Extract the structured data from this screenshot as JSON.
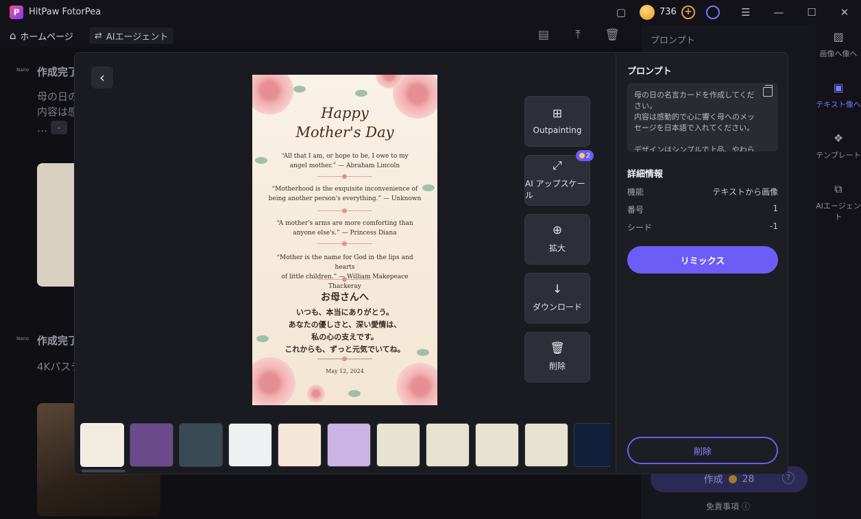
{
  "app": {
    "title": "HitPaw FotorPea",
    "credits": "736",
    "logo": "P"
  },
  "nav": {
    "home": "ホームページ",
    "agent": "AIエージェント"
  },
  "background": {
    "item1_title": "作成完了",
    "item1_line1": "母の日の",
    "item1_line2": "内容は感",
    "item2_title": "作成完了",
    "item2_line1": "4Kパステ",
    "badge_label": "Nano",
    "right_title": "プロンプト",
    "sidebar": [
      "画像へ像へ",
      "テキスト像へ",
      "テンプレート",
      "AIエージェント"
    ],
    "make_label": "作成",
    "make_cost": "28",
    "disclaimer": "免責事項"
  },
  "card": {
    "title_line1": "Happy",
    "title_line2": "Mother's Day",
    "quotes": [
      {
        "l1": "“All that I am, or hope to be, I owe to my",
        "l2": "angel mother.” — Abraham Lincoln"
      },
      {
        "l1": "“Motherhood is the exquisite inconvenience of",
        "l2": "being another person's everything.” — Unknown"
      },
      {
        "l1": "“A mother's arms are more comforting than",
        "l2": "anyone else's.” — Princess Diana"
      },
      {
        "l1": "“Mother is the name for God in the lips and hearts",
        "l2": "of little children.” — William Makepeace Thackeray"
      }
    ],
    "jp_head": "お母さんへ",
    "jp_lines": [
      "いつも、本当にありがとう。",
      "あなたの優しさと、深い愛情は、",
      "私の心の支えです。",
      "これからも、ずっと元気でいてね。"
    ],
    "date": "May 12, 2024"
  },
  "actions": {
    "outpainting": "Outpainting",
    "upscale": "AI アップスケール",
    "upscale_cost": "2",
    "zoom": "拡大",
    "download": "ダウンロード",
    "delete": "削除"
  },
  "info": {
    "prompt_heading": "プロンプト",
    "prompt_text": "母の日の名言カードを作成してください。\n内容は感動的で心に響く母へのメッセージを日本語で入れてください。\n\nデザインはシンプルで上品、やわらかい",
    "details_heading": "詳細情報",
    "rows": [
      {
        "k": "機能",
        "v": "テキストから画像"
      },
      {
        "k": "番号",
        "v": "1"
      },
      {
        "k": "シード",
        "v": "-1"
      }
    ],
    "remix": "リミックス",
    "delete": "削除"
  },
  "thumbnails": [
    {
      "name": "thumb-quote-card",
      "bg": "#f3ece0",
      "active": true
    },
    {
      "name": "thumb-flowers",
      "bg": "#6a4a8a"
    },
    {
      "name": "thumb-portrait",
      "bg": "#3a4a55"
    },
    {
      "name": "thumb-eyes",
      "bg": "#eef0f2"
    },
    {
      "name": "thumb-puppy",
      "bg": "#f4e6d8"
    },
    {
      "name": "thumb-anime",
      "bg": "#c9b4e4"
    },
    {
      "name": "thumb-easter-1",
      "bg": "#e6e4d0"
    },
    {
      "name": "thumb-easter-2",
      "bg": "#e6e4d0"
    },
    {
      "name": "thumb-easter-3",
      "bg": "#e6e4d0"
    },
    {
      "name": "thumb-easter-4",
      "bg": "#e6e4d0"
    },
    {
      "name": "thumb-planet",
      "bg": "#10203a"
    }
  ],
  "colors": {
    "accent": "#6e5cf6",
    "coin": "#e8a53a"
  }
}
